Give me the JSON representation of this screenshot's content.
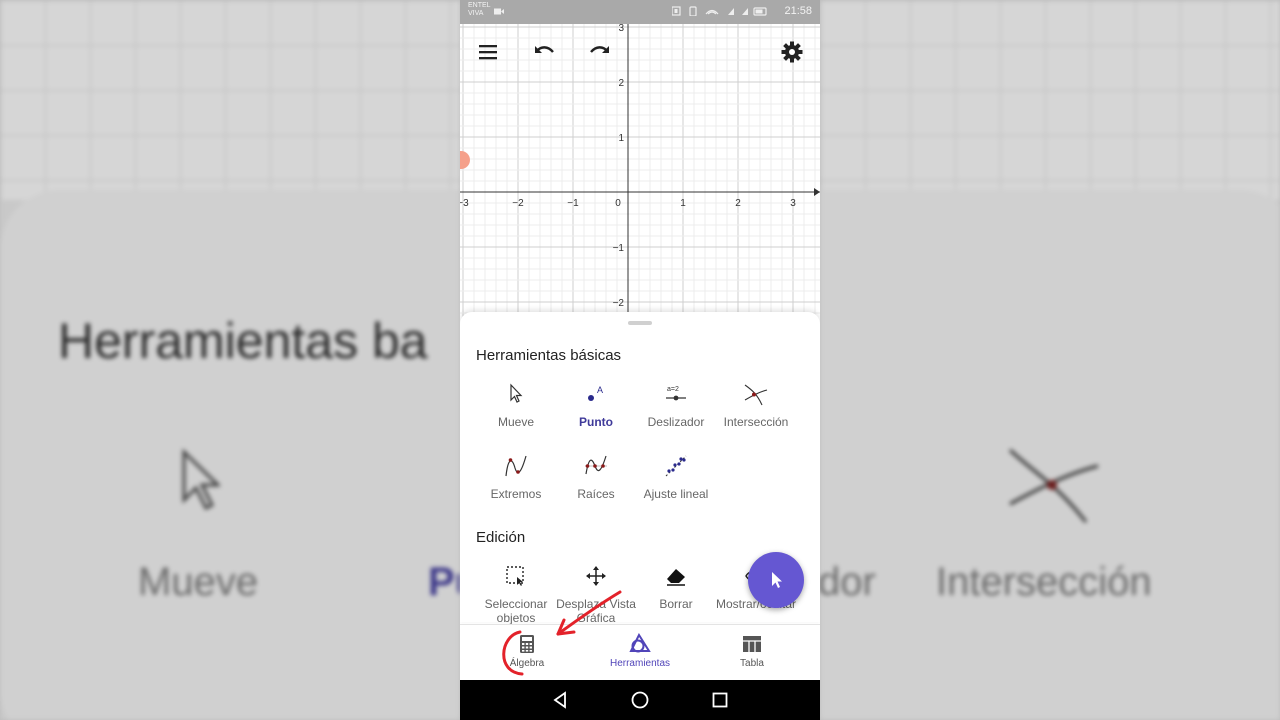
{
  "status_bar": {
    "carrier": "ENTEL",
    "carrier_sub": "VIVA",
    "time": "21:58"
  },
  "graph": {
    "x_ticks": [
      "−3",
      "−2",
      "−1",
      "0",
      "1",
      "2",
      "3"
    ],
    "y_ticks": [
      "3",
      "2",
      "1",
      "−1",
      "−2"
    ],
    "toolbar_icons": [
      "menu-icon",
      "undo-icon",
      "redo-icon",
      "settings-icon"
    ]
  },
  "tools_panel": {
    "basic_title": "Herramientas básicas",
    "basic_tools": [
      {
        "label": "Mueve",
        "icon": "cursor-arrow-icon",
        "active": false
      },
      {
        "label": "Punto",
        "icon": "point-icon",
        "active": true
      },
      {
        "label": "Deslizador",
        "icon": "slider-icon",
        "active": false
      },
      {
        "label": "Intersección",
        "icon": "intersection-icon",
        "active": false
      },
      {
        "label": "Extremos",
        "icon": "extremum-icon",
        "active": false
      },
      {
        "label": "Raíces",
        "icon": "roots-icon",
        "active": false
      },
      {
        "label": "Ajuste lineal",
        "icon": "fit-line-icon",
        "active": false
      }
    ],
    "edit_title": "Edición",
    "edit_tools": [
      {
        "label": "Seleccionar objetos",
        "icon": "select-objects-icon"
      },
      {
        "label": "Desplaza Vista Gráfica",
        "icon": "move-graphics-icon"
      },
      {
        "label": "Borrar",
        "icon": "eraser-icon"
      },
      {
        "label": "Mostrar/ocultar",
        "icon": "show-hide-icon"
      }
    ]
  },
  "bottom_nav": [
    {
      "label": "Álgebra",
      "icon": "calculator-icon",
      "active": false
    },
    {
      "label": "Herramientas",
      "icon": "tools-icon",
      "active": true
    },
    {
      "label": "Tabla",
      "icon": "table-icon",
      "active": false
    }
  ],
  "background": {
    "left_text": "Herramientas ba",
    "left_label": "Mueve",
    "left_label_accent": "Pu",
    "right_label_partial": "dor",
    "right_label": "Intersección"
  },
  "colors": {
    "accent": "#6557d2",
    "active_text": "#3f3a9a",
    "annotation": "#e3222a"
  }
}
